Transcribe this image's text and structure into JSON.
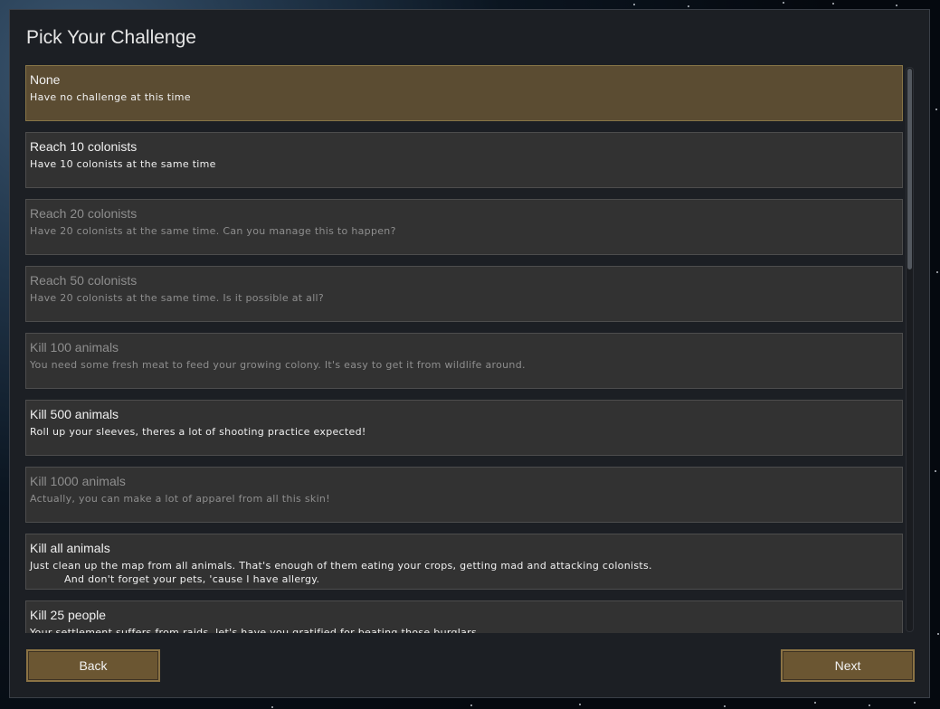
{
  "dialog": {
    "title": "Pick Your Challenge",
    "back_label": "Back",
    "next_label": "Next"
  },
  "challenges": [
    {
      "name": "None",
      "description": "Have no challenge at this time",
      "state": "selected"
    },
    {
      "name": "Reach 10 colonists",
      "description": "Have 10 colonists at the same time",
      "state": "available"
    },
    {
      "name": "Reach 20 colonists",
      "description": "Have 20 colonists at the same time. Can you manage this to happen?",
      "state": "disabled"
    },
    {
      "name": "Reach 50 colonists",
      "description": "Have 20 colonists at the same time. Is it possible at all?",
      "state": "disabled"
    },
    {
      "name": "Kill 100 animals",
      "description": "You need some fresh meat to feed your growing colony. It's easy to get it from wildlife around.",
      "state": "disabled"
    },
    {
      "name": "Kill 500 animals",
      "description": "Roll up your sleeves, theres a lot of shooting practice expected!",
      "state": "available"
    },
    {
      "name": "Kill 1000 animals",
      "description": "Actually, you can make a lot of apparel from all this skin!",
      "state": "disabled"
    },
    {
      "name": "Kill all animals",
      "description": "Just clean up the map from all animals. That's enough of them eating your crops, getting mad and attacking colonists.\n          And don't forget your pets, 'cause I have allergy.",
      "state": "available"
    },
    {
      "name": "Kill 25 people",
      "description": "Your settlement suffers from raids, let's have you gratified for beating those burglars",
      "state": "available"
    }
  ],
  "colors": {
    "selected_bg": "#5b4c32",
    "item_bg": "#323232",
    "button_bg": "#6b5632",
    "disabled_text": "#8e8e8e"
  }
}
